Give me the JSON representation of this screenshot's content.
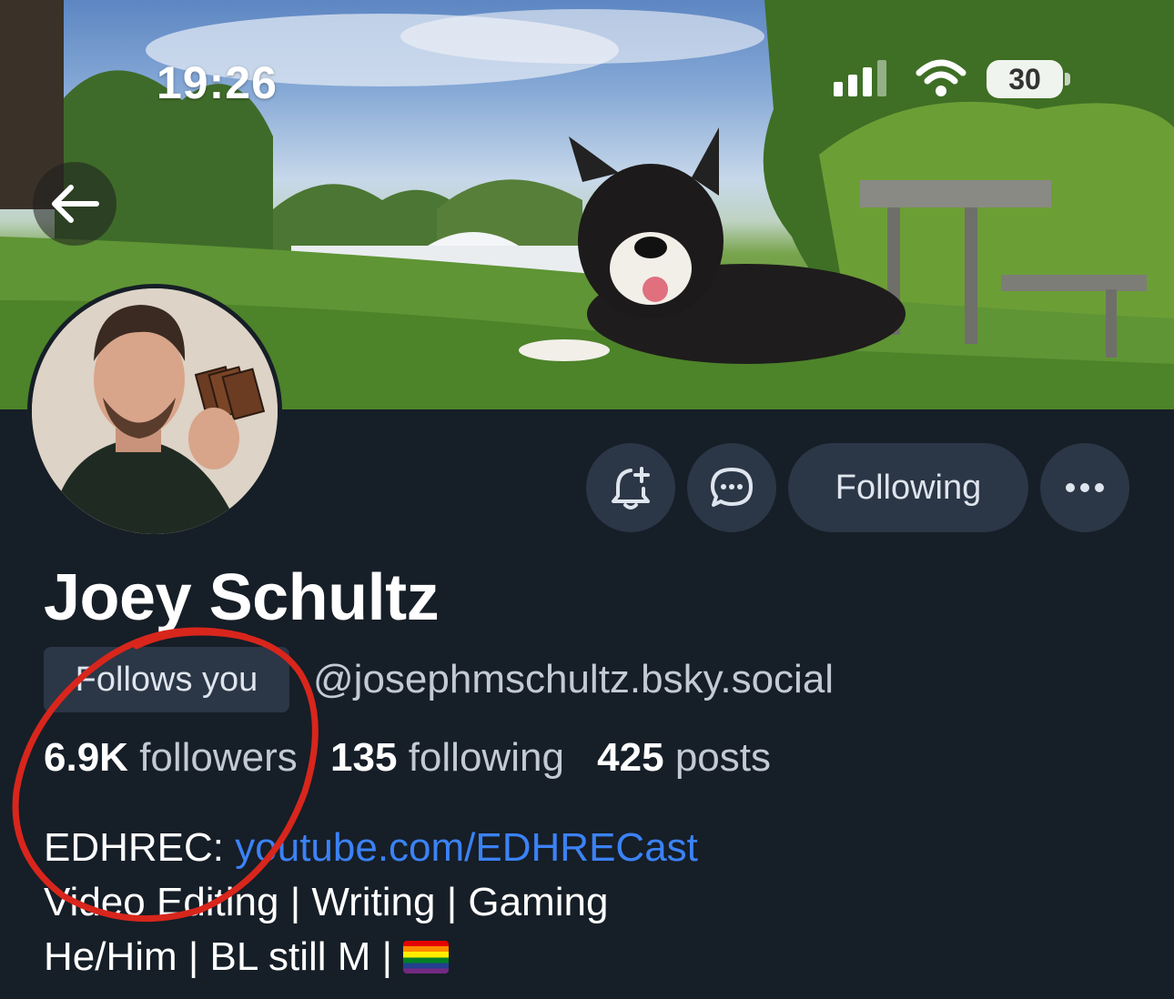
{
  "status_bar": {
    "time": "19:26",
    "battery": "30",
    "icons": [
      "signal-icon",
      "wifi-icon",
      "battery-icon"
    ]
  },
  "nav": {
    "back_icon": "arrow-left-icon"
  },
  "profile": {
    "display_name": "Joey Schultz",
    "follows_you_label": "Follows you",
    "handle": "@josephmschultz.bsky.social",
    "stats": {
      "followers_count": "6.9K",
      "followers_label": "followers",
      "following_count": "135",
      "following_label": "following",
      "posts_count": "425",
      "posts_label": "posts"
    },
    "bio": {
      "line1_prefix": "EDHREC: ",
      "line1_link": "youtube.com/EDHRECast",
      "line2": "Video Editing | Writing | Gaming",
      "line3": "He/Him | BL still M | "
    }
  },
  "actions": {
    "notify_icon": "bell-plus-icon",
    "message_icon": "chat-bubble-icon",
    "following_label": "Following",
    "more_icon": "ellipsis-icon"
  },
  "colors": {
    "background": "#161e27",
    "button_bg": "#2b3646",
    "link": "#3b82f6",
    "annotation": "#d8261c"
  }
}
